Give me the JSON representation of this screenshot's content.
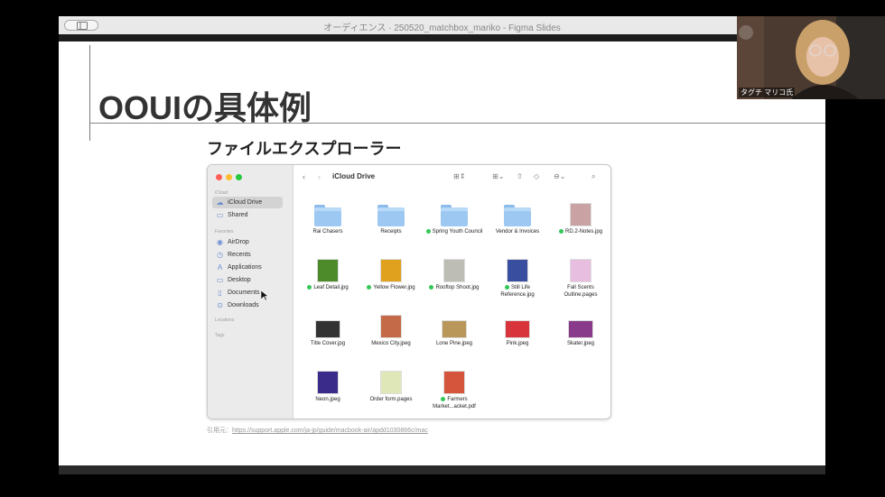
{
  "window": {
    "title": "オーディエンス · 250520_matchbox_mariko - Figma Slides"
  },
  "slide": {
    "title": "OOUIの具体例",
    "subtitle": "ファイルエクスプローラー",
    "citation_prefix": "引用元：",
    "citation_url": "https://support.apple.com/ja-jp/guide/macbook-air/apdd1030866c/mac"
  },
  "finder": {
    "location": "iCloud Drive",
    "sidebar": {
      "icloud_header": "iCloud",
      "favorites_header": "Favorites",
      "locations_header": "Locations",
      "tags_header": "Tags",
      "items": [
        {
          "label": "iCloud Drive",
          "icon": "cloud-icon",
          "selected": true
        },
        {
          "label": "Shared",
          "icon": "shared-folder-icon"
        },
        {
          "label": "AirDrop",
          "icon": "airdrop-icon"
        },
        {
          "label": "Recents",
          "icon": "clock-icon"
        },
        {
          "label": "Applications",
          "icon": "applications-icon"
        },
        {
          "label": "Desktop",
          "icon": "desktop-icon"
        },
        {
          "label": "Documents",
          "icon": "document-icon"
        },
        {
          "label": "Downloads",
          "icon": "download-icon"
        }
      ]
    },
    "files": [
      {
        "name": "Rai Chasers",
        "type": "folder",
        "synced": false
      },
      {
        "name": "Receipts",
        "type": "folder",
        "synced": false
      },
      {
        "name": "Spring Youth Council",
        "type": "folder",
        "synced": true
      },
      {
        "name": "Vendor & Invoices",
        "type": "folder",
        "synced": false
      },
      {
        "name": "RD.2-Notes.jpg",
        "type": "image",
        "synced": true,
        "color": "#c9a3a3"
      },
      {
        "name": "Leaf Detail.jpg",
        "type": "image",
        "synced": true,
        "color": "#4c8a2a"
      },
      {
        "name": "Yellow Flower.jpg",
        "type": "image",
        "synced": true,
        "color": "#e0a21e"
      },
      {
        "name": "Rooftop Shoot.jpg",
        "type": "image",
        "synced": true,
        "color": "#bdbdb5"
      },
      {
        "name": "Still Life Reference.jpg",
        "type": "image",
        "synced": true,
        "color": "#3a4ea0"
      },
      {
        "name": "Fall Scents Outline.pages",
        "type": "pages",
        "synced": false,
        "color": "#e7bde0"
      },
      {
        "name": "Title Cover.jpg",
        "type": "image",
        "synced": false,
        "color": "#333333"
      },
      {
        "name": "Mexico City.jpeg",
        "type": "image",
        "synced": false,
        "color": "#c56a48"
      },
      {
        "name": "Lone Pine.jpeg",
        "type": "image",
        "synced": false,
        "color": "#b9965a"
      },
      {
        "name": "Pink.jpeg",
        "type": "image",
        "synced": false,
        "color": "#d8343c"
      },
      {
        "name": "Skater.jpeg",
        "type": "image",
        "synced": false,
        "color": "#8a3a8a"
      },
      {
        "name": "Neon.jpeg",
        "type": "image",
        "synced": false,
        "color": "#3a2a8a"
      },
      {
        "name": "Order form.pages",
        "type": "pages",
        "synced": false,
        "color": "#dfe7b8"
      },
      {
        "name": "Farmers Market...acket.pdf",
        "type": "pdf",
        "synced": true,
        "color": "#d4543c"
      }
    ]
  },
  "webcam": {
    "name": "タグチ マリコ氏"
  },
  "colors": {
    "accent": "#3478f6",
    "synced_dot": "#34c759",
    "folder": "#9dc8f2"
  }
}
